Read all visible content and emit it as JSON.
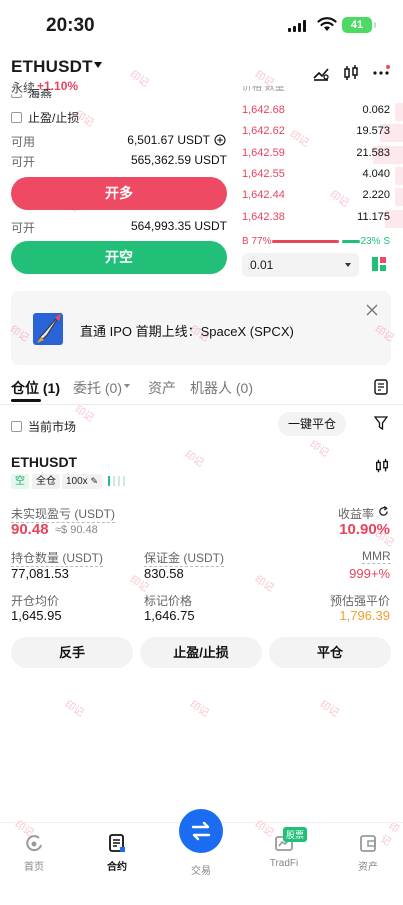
{
  "status_bar": {
    "time": "20:30",
    "battery": "41"
  },
  "header": {
    "pair": "ETHUSDT",
    "contract_type": "永续",
    "change": "+1.10%"
  },
  "trade_panel": {
    "cut_label": "海燕",
    "tp_sl_label": "止盈/止损",
    "available_label": "可用",
    "available_value": "6,501.67 USDT",
    "can_open_label": "可开",
    "can_open_long_value": "565,362.59 USDT",
    "open_long_label": "开多",
    "can_open_short_value": "564,993.35 USDT",
    "open_short_label": "开空"
  },
  "order_book": {
    "header_cut": "价格 数量",
    "asks": [
      {
        "price": "1,642.68",
        "qty": "0.062",
        "depth": 0.05
      },
      {
        "price": "1,642.62",
        "qty": "19.573",
        "depth": 0.15
      },
      {
        "price": "1,642.59",
        "qty": "21.583",
        "depth": 0.2
      },
      {
        "price": "1,642.55",
        "qty": "4.040",
        "depth": 0.05
      },
      {
        "price": "1,642.44",
        "qty": "2.220",
        "depth": 0.05
      },
      {
        "price": "1,642.38",
        "qty": "11.175",
        "depth": 0.12
      }
    ],
    "buy_ratio": "B 77%",
    "sell_ratio": "23% S",
    "depth_step": "0.01"
  },
  "banner": {
    "text": "直通 IPO 首期上线：SpaceX (SPCX)"
  },
  "tabs": [
    {
      "label": "仓位 (1)"
    },
    {
      "label": "委托 (0)"
    },
    {
      "label": "资产"
    },
    {
      "label": "机器人 (0)"
    }
  ],
  "filter": {
    "current_market_label": "当前市场",
    "close_all_label": "一键平仓"
  },
  "position": {
    "symbol": "ETHUSDT",
    "side_tag": "空",
    "margin_tag": "全仓",
    "leverage_tag": "100x",
    "upnl_label": "未实现盈亏 (USDT)",
    "upnl_value": "90.48",
    "upnl_usd": "≈$ 90.48",
    "roe_label": "收益率",
    "roe_value": "10.90%",
    "size_label": "持仓数量 (USDT)",
    "size_value": "77,081.53",
    "margin_label": "保证金 (USDT)",
    "margin_value": "830.58",
    "mmr_label": "MMR",
    "mmr_value": "999+%",
    "entry_label": "开仓均价",
    "entry_value": "1,645.95",
    "mark_label": "标记价格",
    "mark_value": "1,646.75",
    "liq_label": "预估强平价",
    "liq_value": "1,796.39",
    "reverse_label": "反手",
    "tpsl_label": "止盈/止损",
    "close_label": "平仓"
  },
  "bottom_nav": {
    "home": "首页",
    "contract": "合约",
    "trade": "交易",
    "tradfi": "TradFi",
    "tradfi_badge": "股票",
    "assets": "资产"
  },
  "watermark": "印记",
  "colors": {
    "red": "#ef4a63",
    "green": "#22bf78",
    "blue": "#1c6cf2",
    "liq_orange": "#f0a030"
  }
}
